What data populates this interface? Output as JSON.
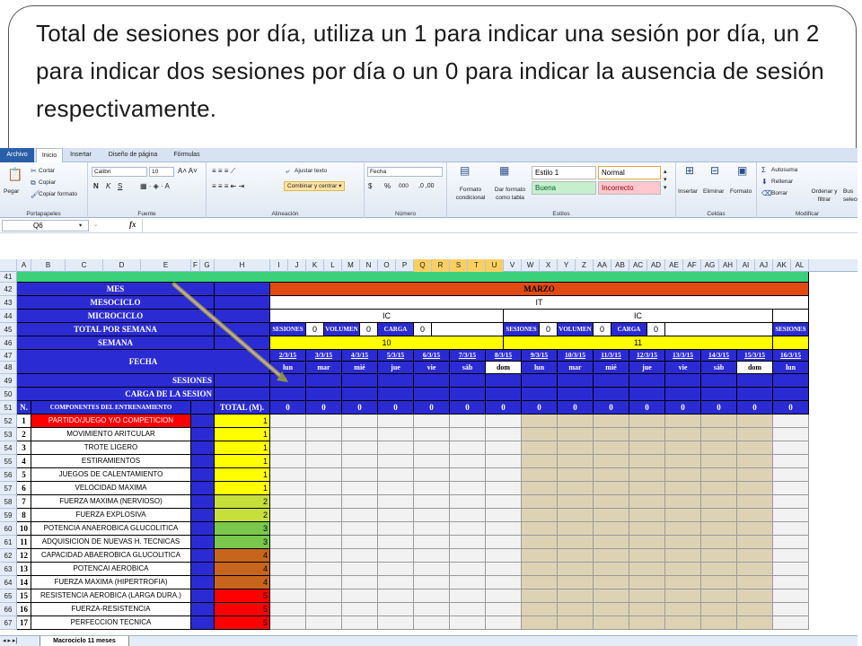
{
  "slide": {
    "title": "Total de sesiones por día, utiliza un 1 para indicar una sesión por día, un 2 para indicar dos sesiones por día o un 0 para indicar la ausencia de sesión respectivamente."
  },
  "ribbon": {
    "tabs": [
      "Archivo",
      "Inicio",
      "Insertar",
      "Diseño de página",
      "Fórmulas"
    ],
    "clipboard": {
      "paste": "Pegar",
      "cut": "Cortar",
      "copy": "Copiar",
      "format_painter": "Copiar formato",
      "group": "Portapapeles"
    },
    "font": {
      "name": "Calibri",
      "size": "10",
      "group": "Fuente",
      "bold": "N",
      "italic": "K",
      "underline": "S"
    },
    "alignment": {
      "wrap": "Ajustar texto",
      "merge": "Combinar y centrar",
      "group": "Alineación"
    },
    "number": {
      "format": "Fecha",
      "group": "Número",
      "currency": "$",
      "percent": "%",
      "thousands": "000"
    },
    "styles": {
      "conditional": "Formato condicional",
      "as_table": "Dar formato como tabla",
      "estilo1": "Estilo 1",
      "normal": "Normal",
      "buena": "Buena",
      "incorrecto": "Incorrecto",
      "group": "Estilos"
    },
    "cells": {
      "insert": "Insertar",
      "delete": "Eliminar",
      "format": "Formato",
      "group": "Celdas"
    },
    "modify": {
      "autosum": "Autosuma",
      "fill": "Rellenar",
      "clear": "Borrar",
      "sort": "Ordenar y filtrar",
      "find": "Bus selecc",
      "group": "Modificar"
    }
  },
  "formula_bar": {
    "name_box": "Q6",
    "fx": "fx"
  },
  "columns": [
    "A",
    "B",
    "C",
    "D",
    "E",
    "F",
    "G",
    "H",
    "I",
    "J",
    "K",
    "L",
    "M",
    "N",
    "O",
    "P",
    "Q",
    "R",
    "S",
    "T",
    "U",
    "V",
    "W",
    "X",
    "Y",
    "Z",
    "AA",
    "AB",
    "AC",
    "AD",
    "AE",
    "AF",
    "AG",
    "AH",
    "AI",
    "AJ",
    "AK",
    "AL"
  ],
  "sheet": {
    "rows": [
      "41",
      "42",
      "43",
      "44",
      "45",
      "46",
      "47",
      "48",
      "49",
      "50",
      "51",
      "52",
      "53",
      "54",
      "55",
      "56",
      "57",
      "58",
      "59",
      "60",
      "61",
      "62",
      "63",
      "64",
      "65",
      "66",
      "67"
    ],
    "labels": {
      "mes": "MES",
      "mesociclo": "MESOCICLO",
      "microciclo": "MICROCICLO",
      "total_semana": "TOTAL POR SEMANA",
      "semana": "SEMANA",
      "fecha": "FECHA",
      "sesiones": "SESIONES",
      "carga": "CARGA DE LA SESION",
      "n": "N.",
      "componentes": "COMPONENTES DEL ENTRENAMIENTO",
      "total": "TOTAL (M)."
    },
    "month": "MARZO",
    "mesociclo_value": "IT",
    "microciclos": [
      "IC",
      "IC"
    ],
    "week_totals": {
      "sesiones_label": "SESIONES",
      "volumen_label": "VOLUMEN",
      "carga_label": "CARGA",
      "value": "0",
      "next_sesiones": "SESIONES"
    },
    "weeks": [
      "10",
      "11"
    ],
    "dates": [
      "2/3/15",
      "3/3/15",
      "4/3/15",
      "5/3/15",
      "6/3/15",
      "7/3/15",
      "8/3/15",
      "9/3/15",
      "10/3/15",
      "11/3/15",
      "12/3/15",
      "13/3/15",
      "14/3/15",
      "15/3/15",
      "16/3/15"
    ],
    "days": [
      "lun",
      "mar",
      "mié",
      "jue",
      "vie",
      "sáb",
      "dom",
      "lun",
      "mar",
      "mié",
      "jue",
      "vie",
      "sáb",
      "dom",
      "lun"
    ],
    "daily_totals": [
      "0",
      "0",
      "0",
      "0",
      "0",
      "0",
      "0",
      "0",
      "0",
      "0",
      "0",
      "0",
      "0",
      "0",
      "0"
    ],
    "components": [
      {
        "n": "1",
        "name": "PARTIDO/JUEGO Y/O COMPETICION",
        "total": "1",
        "color": "#ffff00"
      },
      {
        "n": "2",
        "name": "MOVIMIENTO ARITCULAR",
        "total": "1",
        "color": "#ffff00"
      },
      {
        "n": "3",
        "name": "TROTE LIGERO",
        "total": "1",
        "color": "#ffff00"
      },
      {
        "n": "4",
        "name": "ESTIRAMIENTOS",
        "total": "1",
        "color": "#ffff00"
      },
      {
        "n": "5",
        "name": "JUEGOS DE CALENTAMIENTO",
        "total": "1",
        "color": "#ffff00"
      },
      {
        "n": "6",
        "name": "VELOCIDAD MAXIMA",
        "total": "1",
        "color": "#ffff00"
      },
      {
        "n": "7",
        "name": "FUERZA MAXIMA (NERVIOSO)",
        "total": "2",
        "color": "#c7df3b"
      },
      {
        "n": "8",
        "name": "FUERZA EXPLOSIVA",
        "total": "2",
        "color": "#c7df3b"
      },
      {
        "n": "10",
        "name": "POTENCIA ANAEROBICA GLUCOLITICA",
        "total": "3",
        "color": "#79c84c"
      },
      {
        "n": "11",
        "name": "ADQUISICION DE NUEVAS H. TECNICAS",
        "total": "3",
        "color": "#79c84c"
      },
      {
        "n": "12",
        "name": "CAPACIDAD ABAEROBICA GLUCOLITICA",
        "total": "4",
        "color": "#c8651c"
      },
      {
        "n": "13",
        "name": "POTENCAI AEROBICA",
        "total": "4",
        "color": "#c8651c"
      },
      {
        "n": "14",
        "name": "FUERZA MAXIMA (HIPERTROFIA)",
        "total": "4",
        "color": "#c8651c"
      },
      {
        "n": "15",
        "name": "RESISTENCIA AEROBICA (LARGA DURA.)",
        "total": "5",
        "color": "#ff0000"
      },
      {
        "n": "16",
        "name": "FUERZA-RESISTENCIA",
        "total": "5",
        "color": "#ff0000"
      },
      {
        "n": "17",
        "name": "PERFECCION TECNICA",
        "total": "5",
        "color": "#ff0000"
      }
    ],
    "first_item_highlight": "#ff0000",
    "colors": {
      "header_blue": "#2b2bd4",
      "month_bar": "#e34a12",
      "week_yellow": "#ffff00",
      "green_row": "#3bd17a",
      "weekend_shade": "#ddd3b4",
      "weekday_shade": "#f2f2f2"
    }
  },
  "sheet_tab": "Macrociclo 11 meses"
}
